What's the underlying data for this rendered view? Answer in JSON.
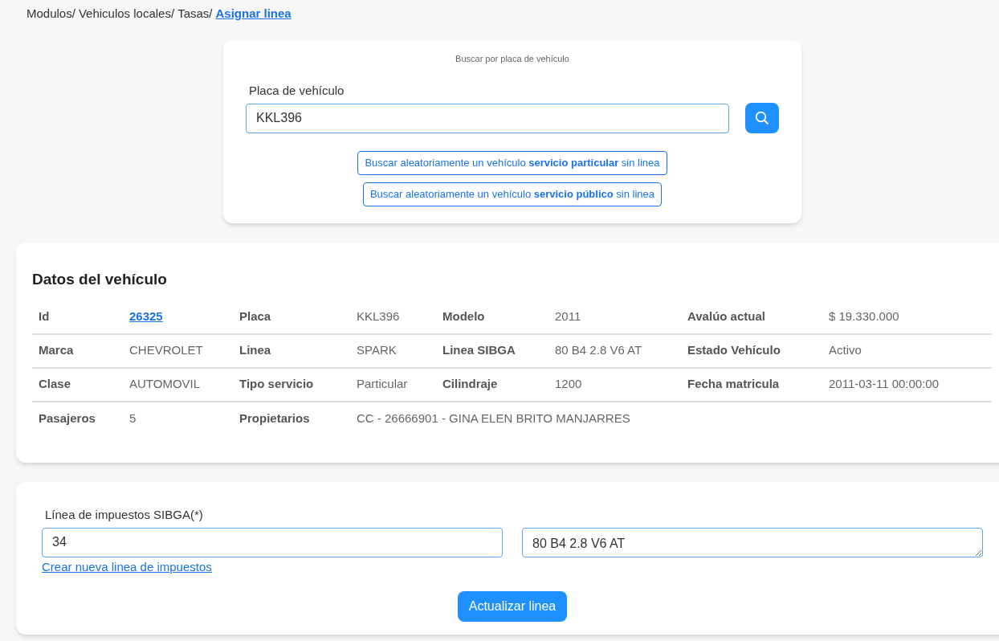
{
  "breadcrumb": [
    {
      "text": "Modulos/",
      "kind": "text"
    },
    {
      "text": "Vehiculos locales/",
      "kind": "text"
    },
    {
      "text": "Tasas/",
      "kind": "text"
    },
    {
      "text": "Asignar linea",
      "kind": "link"
    }
  ],
  "search": {
    "title": "Buscar por placa de vehículo",
    "label": "Placa de vehículo",
    "value": "KKL396",
    "random_buttons": [
      "Buscar aleatoriamente un vehículo **servicio particular** sin linea",
      "Buscar aleatoriamente un vehículo **servicio público** sin linea"
    ]
  },
  "vehicle": {
    "title": "Datos del vehículo",
    "rows": [
      [
        {
          "kind": "label",
          "text": "Id"
        },
        {
          "kind": "link",
          "text": "26325"
        },
        {
          "kind": "label",
          "text": "Placa"
        },
        {
          "kind": "value",
          "text": "KKL396"
        },
        {
          "kind": "label",
          "text": "Modelo"
        },
        {
          "kind": "value",
          "text": "2011"
        },
        {
          "kind": "label",
          "text": "Avalúo actual"
        },
        {
          "kind": "value",
          "text": "$ 19.330.000"
        }
      ],
      [
        {
          "kind": "label",
          "text": "Marca"
        },
        {
          "kind": "value",
          "text": "CHEVROLET"
        },
        {
          "kind": "label",
          "text": "Linea"
        },
        {
          "kind": "value",
          "text": "SPARK"
        },
        {
          "kind": "label",
          "text": "Linea SIBGA"
        },
        {
          "kind": "value",
          "text": "80 B4 2.8 V6 AT"
        },
        {
          "kind": "label",
          "text": "Estado Vehículo"
        },
        {
          "kind": "value",
          "text": "Activo"
        }
      ],
      [
        {
          "kind": "label",
          "text": "Clase"
        },
        {
          "kind": "value",
          "text": "AUTOMOVIL"
        },
        {
          "kind": "label",
          "text": "Tipo servicio"
        },
        {
          "kind": "value",
          "text": "Particular"
        },
        {
          "kind": "label",
          "text": "Cilindraje"
        },
        {
          "kind": "value",
          "text": "1200"
        },
        {
          "kind": "label",
          "text": "Fecha matricula"
        },
        {
          "kind": "value",
          "text": "2011-03-11 00:00:00"
        }
      ],
      [
        {
          "kind": "label",
          "text": "Pasajeros"
        },
        {
          "kind": "value",
          "text": "5"
        },
        {
          "kind": "label",
          "text": "Propietarios"
        },
        {
          "kind": "wide",
          "text": "CC - 26666901 - GINA ELEN BRITO MANJARRES"
        }
      ]
    ]
  },
  "tax": {
    "label": "Línea de impuestos SIBGA(*)",
    "code": "34",
    "description": "80 B4 2.8 V6 AT",
    "create_link": "Crear nueva linea de impuestos",
    "submit": "Actualizar linea"
  }
}
